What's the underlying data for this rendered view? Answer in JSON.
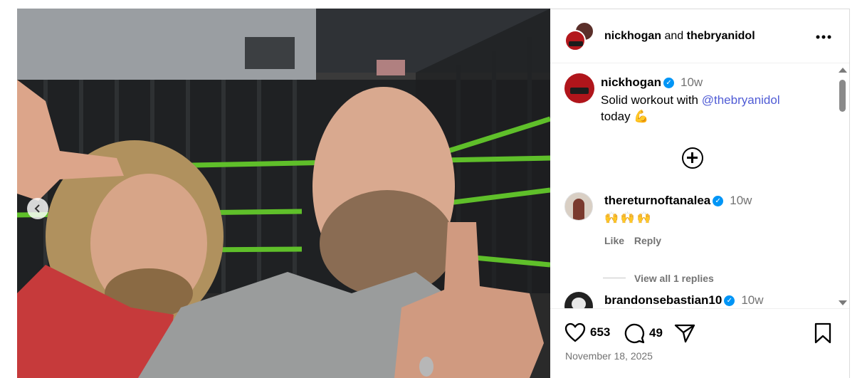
{
  "post": {
    "header": {
      "user1": "nickhogan",
      "joiner": "and",
      "user2": "thebryanidol",
      "more_icon": "more-horizontal-icon"
    },
    "caption": {
      "username": "nickhogan",
      "verified": true,
      "time": "10w",
      "text_before": "Solid workout with ",
      "mention": "@thebryanidol",
      "text_after": "today 💪"
    },
    "comments": [
      {
        "username": "thereturnoftanalea",
        "verified": true,
        "time": "10w",
        "text": "🙌🙌🙌",
        "like_label": "Like",
        "reply_label": "Reply",
        "view_replies": "View all 1 replies"
      },
      {
        "username": "brandonsebastian10",
        "verified": true,
        "time": "10w"
      }
    ],
    "likes": "653",
    "comment_count": "49",
    "date": "November 18, 2025",
    "icons": {
      "like": "heart-icon",
      "comment": "comment-bubble-icon",
      "share": "send-icon",
      "save": "bookmark-icon",
      "add": "plus-circle-icon",
      "carousel_prev": "chevron-left-icon"
    },
    "colors": {
      "verified": "#0095f6",
      "mention": "#4f5bd5",
      "muted": "#737373",
      "ring_ropes": "#5fbf2a"
    }
  }
}
